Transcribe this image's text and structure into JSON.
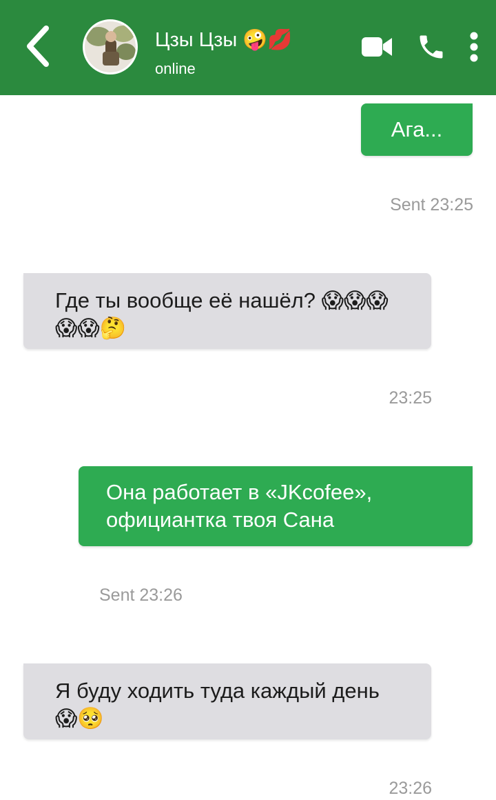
{
  "header": {
    "name": "Цзы Цзы 🤪💋",
    "status": "online",
    "background_color": "#2b8a3e"
  },
  "icons": {
    "back": "chevron-left-icon",
    "video": "video-camera-icon",
    "call": "phone-icon",
    "more": "more-vertical-icon"
  },
  "messages": [
    {
      "direction": "outgoing",
      "text": "Ага...",
      "time": "Sent 23:25"
    },
    {
      "direction": "incoming",
      "text": "Где ты вообще её нашёл? 😱😱😱😱😱🤔",
      "time": "23:25"
    },
    {
      "direction": "outgoing",
      "text": "Она работает в «JKcofee», официантка твоя Сана",
      "time": "Sent 23:26"
    },
    {
      "direction": "incoming",
      "text": "Я буду ходить туда каждый день 😱🥺",
      "time": "23:26"
    }
  ],
  "colors": {
    "outgoing_bubble": "#2eab52",
    "incoming_bubble": "#dedde1",
    "timestamp": "#9a9a9a"
  }
}
